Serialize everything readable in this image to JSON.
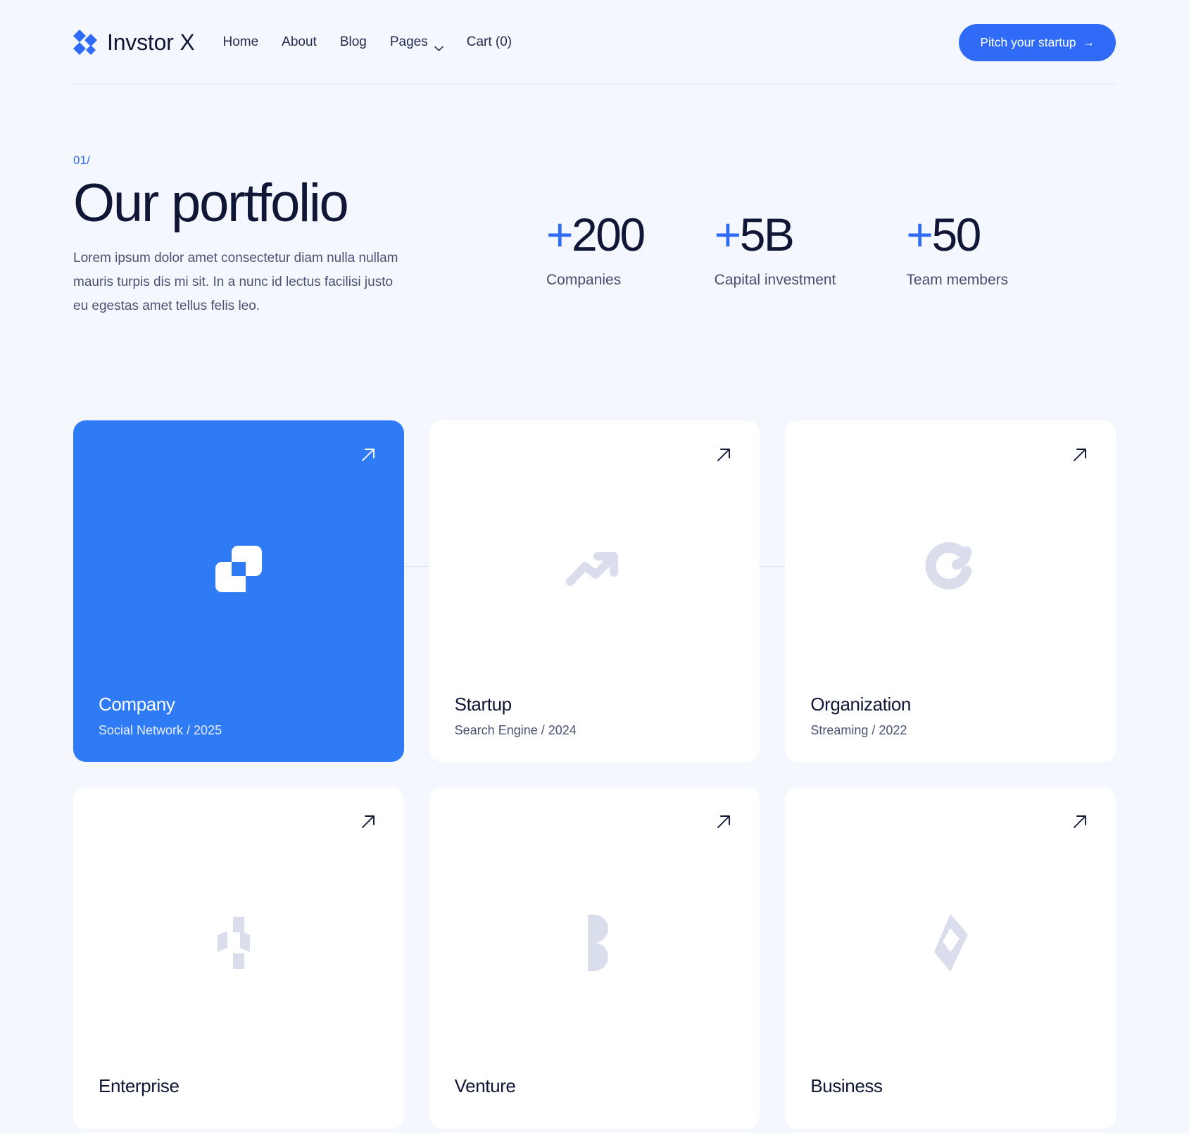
{
  "theme": {
    "accent": "#2f6bf6",
    "card_accent": "#2f7bf6",
    "page_bg": "#f4f7fe",
    "ink": "#101736",
    "muted": "#4a5373"
  },
  "header": {
    "brand": {
      "name": "Invstor X",
      "logo_icon": "diamond-cluster-icon"
    },
    "nav": [
      {
        "label": "Home",
        "has_caret": false
      },
      {
        "label": "About",
        "has_caret": false
      },
      {
        "label": "Blog",
        "has_caret": false
      },
      {
        "label": "Pages",
        "has_caret": true
      },
      {
        "label": "Cart (0)",
        "has_caret": false
      }
    ],
    "cta": {
      "label": "Pitch your startup",
      "arrow": "→"
    }
  },
  "hero": {
    "eyebrow": "01/",
    "title": "Our portfolio",
    "paragraph": "Lorem ipsum dolor amet consectetur diam nulla nullam mauris turpis dis mi sit. In a nunc id lectus facilisi justo eu egestas amet tellus felis leo."
  },
  "stats": [
    {
      "plus": "+",
      "value": "200",
      "label": "Companies"
    },
    {
      "plus": "+",
      "value": "5B",
      "label": "Capital investment"
    },
    {
      "plus": "+",
      "value": "50",
      "label": "Team members"
    }
  ],
  "portfolio": {
    "cards": [
      {
        "title": "Company",
        "meta": "Social Network / 2025",
        "icon": "overlapping-squares-icon",
        "featured": true
      },
      {
        "title": "Startup",
        "meta": "Search Engine / 2024",
        "icon": "trending-up-icon",
        "featured": false
      },
      {
        "title": "Organization",
        "meta": "Streaming / 2022",
        "icon": "c-arc-icon",
        "featured": false
      },
      {
        "title": "Enterprise",
        "meta": "",
        "icon": "shifted-bars-icon",
        "featured": false
      },
      {
        "title": "Venture",
        "meta": "",
        "icon": "split-circle-icon",
        "featured": false
      },
      {
        "title": "Business",
        "meta": "",
        "icon": "diamond-outline-icon",
        "featured": false
      }
    ],
    "arrow_icon": "arrow-up-right-icon"
  }
}
